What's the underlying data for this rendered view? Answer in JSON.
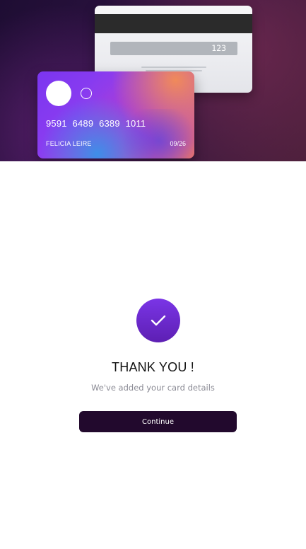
{
  "card_back": {
    "cvv": "123"
  },
  "card_front": {
    "number": "9591  6489  6389  1011",
    "holder": "FELICIA LEIRE",
    "expiry": "09/26"
  },
  "success": {
    "icon": "checkmark-icon",
    "title": "THANK YOU !",
    "subtitle": "We've added your card details",
    "button_label": "Continue"
  },
  "colors": {
    "accent": "#6a2bd0",
    "button_bg": "#22092d",
    "hero_bg": "#2c1240"
  }
}
